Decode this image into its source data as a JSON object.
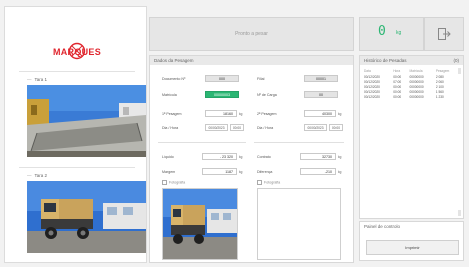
{
  "brand": {
    "logo_text": "MARQUES",
    "accent": "#e0262e"
  },
  "tares": [
    {
      "label": "Tara 1"
    },
    {
      "label": "Tara 2"
    }
  ],
  "header": {
    "bascule_label": "Pronto a pesar",
    "weight_value": "0",
    "weight_unit": "kg",
    "exit_icon": "exit-icon",
    "weight_color": "#2bb673"
  },
  "form": {
    "title": "Dados da Pesagem",
    "documento_label": "Documento Nº",
    "documento_value": "000",
    "filial_label": "Filial",
    "filial_value": "00001",
    "matricula_label": "Matrícula",
    "matricula_value": "00000003",
    "carga_label": "Nº de Carga",
    "carga_value": "00",
    "pesagem1_label": "1ª Pesagem",
    "pesagem1_value": "18160",
    "pesagem2_label": "2ª Pesagem",
    "pesagem2_value": "40300",
    "diahora1_label": "Dia / Hora",
    "date1": "00/00/2023",
    "time1": "00:00",
    "diahora2_label": "Dia / Hora",
    "date2": "00/00/2023",
    "time2": "00:00",
    "unit": "kg",
    "liquido_label": "Líquido",
    "liquido_value": "- 23 320",
    "contrato_label": "Contrato",
    "contrato_value": "32730",
    "margem_label": "Margem",
    "margem_value": "1187",
    "diferenca_label": "Diferença",
    "diferenca_value": "-210",
    "check1_label": "Fotografia",
    "check2_label": "Fotografia"
  },
  "history": {
    "title": "Histórico de Pesadas",
    "count": "(0)",
    "columns": [
      "Data",
      "Hora",
      "Matrícula",
      "Pesagem"
    ],
    "rows": [
      [
        "00/12/2020",
        "00:00",
        "00000000",
        "2 080"
      ],
      [
        "00/12/2020",
        "07:00",
        "00000000",
        "2 060"
      ],
      [
        "00/12/2020",
        "00:00",
        "00000000",
        "2 100"
      ],
      [
        "00/12/2020",
        "00:00",
        "00000000",
        "1 560"
      ],
      [
        "00/12/2020",
        "00:00",
        "00000000",
        "1 230"
      ]
    ]
  },
  "projection": {
    "title": "Painel de controlo",
    "button_label": "Imprimir"
  }
}
